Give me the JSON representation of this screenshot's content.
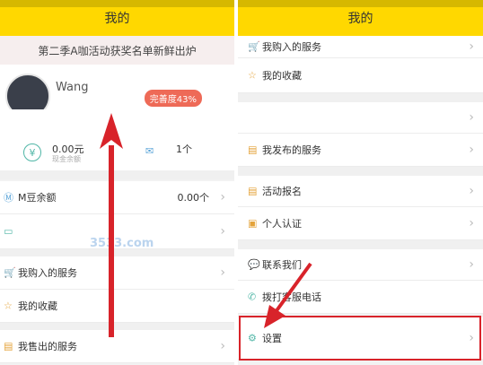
{
  "left": {
    "title": "我的",
    "banner": "第二季A咖活动获奖名单新鲜出炉",
    "username": "Wang",
    "completion_badge": "完善度43%",
    "balance_amount": "0.00元",
    "balance_label": "现金余额",
    "coupon_count": "1个",
    "mbean_label": "M豆余额",
    "mbean_value": "0.00个",
    "bought_label": "我购入的服务",
    "favorites_label": "我的收藏",
    "sold_label": "我售出的服务"
  },
  "right": {
    "title": "我的",
    "bought_label": "我购入的服务",
    "favorites_label": "我的收藏",
    "published_label": "我发布的服务",
    "activity_label": "活动报名",
    "personal_label": "个人认证",
    "contact_label": "联系我们",
    "hotline_label": "拨打客服电话",
    "settings_label": "设置"
  },
  "watermark": "3533.com",
  "accent": "#ffd800",
  "highlight_color": "#d8232a",
  "icons": [
    "yen-icon",
    "envelope-icon",
    "m-bean-icon",
    "wallet-icon",
    "cart-icon",
    "star-icon",
    "file-icon",
    "gear-icon",
    "phone-icon",
    "chat-icon",
    "chevron-right-icon",
    "arrow-icon"
  ]
}
